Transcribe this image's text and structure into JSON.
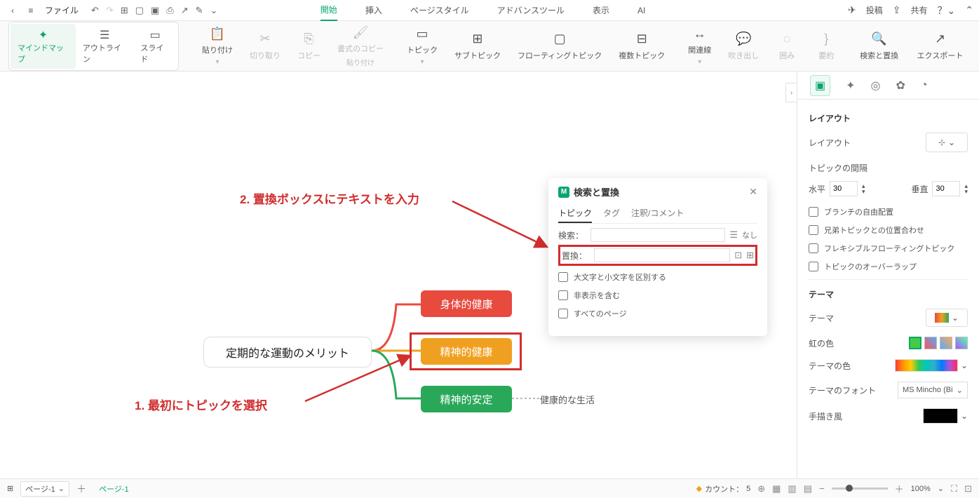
{
  "topbar": {
    "file": "ファイル",
    "tabs": {
      "start": "開始",
      "insert": "挿入",
      "pageStyle": "ページスタイル",
      "advance": "アドバンスツール",
      "view": "表示",
      "ai": "AI"
    },
    "right": {
      "post": "投稿",
      "share": "共有"
    }
  },
  "modes": {
    "mindmap": "マインドマップ",
    "outline": "アウトライン",
    "slide": "スライド"
  },
  "ribbon": {
    "paste": "貼り付け",
    "cut": "切り取り",
    "copy": "コピー",
    "formatCopy": "書式のコピー",
    "formatCopy2": "貼り付け",
    "topic": "トピック",
    "subtopic": "サブトピック",
    "floating": "フローティングトピック",
    "multi": "複数トピック",
    "relation": "関連線",
    "callout": "吹き出し",
    "boundary": "囲み",
    "summary": "要約",
    "searchReplace": "検索と置換",
    "export": "エクスポート"
  },
  "canvas": {
    "root": "定期的な運動のメリット",
    "t1": "身体的健康",
    "t2": "精神的健康",
    "t3": "精神的安定",
    "free": "健康的な生活",
    "anno1": "2. 置換ボックスにテキストを入力",
    "anno2": "1. 最初にトピックを選択"
  },
  "searchPanel": {
    "title": "検索と置換",
    "tabs": {
      "topic": "トピック",
      "tag": "タグ",
      "comment": "注釈/コメント"
    },
    "searchLabel": "検索：",
    "replaceLabel": "置換：",
    "none": "なし",
    "check1": "大文字と小文字を区別する",
    "check2": "非表示を含む",
    "check3": "すべてのページ"
  },
  "rightPanel": {
    "sectionLayout": "レイアウト",
    "layout": "レイアウト",
    "spacing": "トピックの間隔",
    "horiz": "水平",
    "horizVal": "30",
    "vert": "垂直",
    "vertVal": "30",
    "chk1": "ブランチの自由配置",
    "chk2": "兄弟トピックとの位置合わせ",
    "chk3": "フレキシブルフローティングトピック",
    "chk4": "トピックのオーバーラップ",
    "sectionTheme": "テーマ",
    "theme": "テーマ",
    "rainbow": "虹の色",
    "themeColor": "テーマの色",
    "themeFont": "テーマのフォント",
    "fontVal": "MS Mincho (Bi",
    "handdrawn": "手描き風"
  },
  "bottom": {
    "page": "ページ-1",
    "pageTab": "ページ-1",
    "count": "カウント：",
    "countVal": "5",
    "zoom": "100%"
  }
}
